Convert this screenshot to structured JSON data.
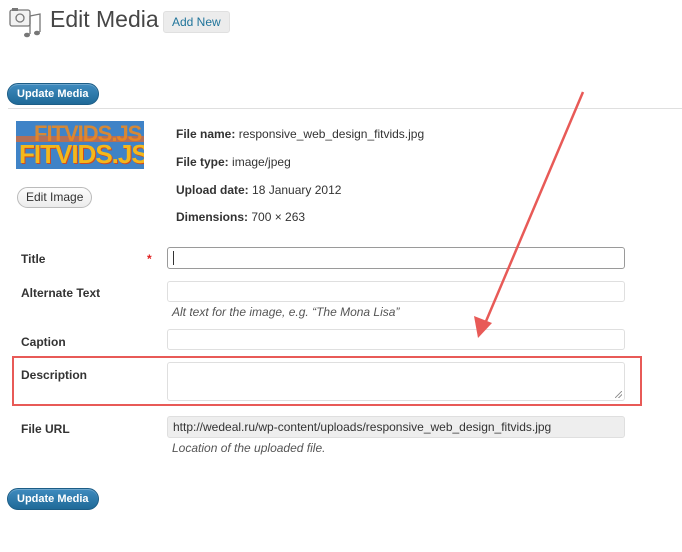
{
  "header": {
    "title": "Edit Media",
    "add_new": "Add New",
    "icon": "media-library-icon"
  },
  "buttons": {
    "update_top": "Update Media",
    "update_bottom": "Update Media",
    "edit_image": "Edit Image"
  },
  "thumbnail": {
    "text": "FITVIDS.JS",
    "text_back": "FITVIDS.JS"
  },
  "file_info": {
    "name_label": "File name:",
    "name_value": "responsive_web_design_fitvids.jpg",
    "type_label": "File type:",
    "type_value": "image/jpeg",
    "date_label": "Upload date:",
    "date_value": "18 January 2012",
    "dims_label": "Dimensions:",
    "dims_value": "700 × 263"
  },
  "form": {
    "title_label": "Title",
    "required_mark": "*",
    "title_value": "",
    "alt_label": "Alternate Text",
    "alt_value": "",
    "alt_help": "Alt text for the image, e.g. “The Mona Lisa”",
    "caption_label": "Caption",
    "caption_value": "",
    "description_label": "Description",
    "description_value": "",
    "url_label": "File URL",
    "url_value": "http://wedeal.ru/wp-content/uploads/responsive_web_design_fitvids.jpg",
    "url_help": "Location of the uploaded file."
  },
  "colors": {
    "primary_button": "#21759b",
    "annotation": "#e85a57",
    "required": "#e02020"
  }
}
